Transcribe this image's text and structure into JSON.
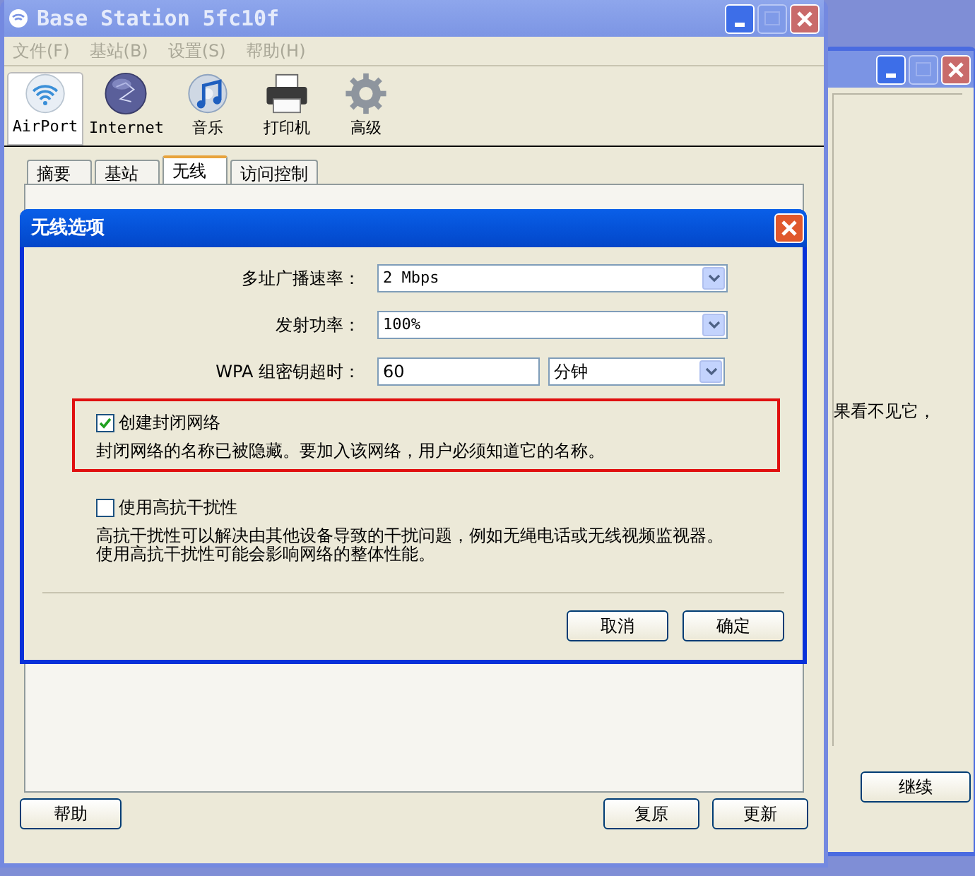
{
  "window": {
    "title": "Base Station 5fc10f"
  },
  "menu": [
    "文件(F)",
    "基站(B)",
    "设置(S)",
    "帮助(H)"
  ],
  "toolbar": [
    {
      "kind": "airport",
      "label": "AirPort",
      "selected": true
    },
    {
      "kind": "internet",
      "label": "Internet",
      "selected": false
    },
    {
      "kind": "music",
      "label": "音乐",
      "selected": false
    },
    {
      "kind": "printer",
      "label": "打印机",
      "selected": false
    },
    {
      "kind": "advanced",
      "label": "高级",
      "selected": false
    }
  ],
  "tabs": [
    {
      "label": "摘要",
      "selected": false
    },
    {
      "label": "基站",
      "selected": false
    },
    {
      "label": "无线",
      "selected": true
    },
    {
      "label": "访问控制",
      "selected": false
    }
  ],
  "footer_buttons": {
    "left": [
      "帮助"
    ],
    "right": [
      "复原",
      "更新"
    ]
  },
  "back_window": {
    "text": "果看不见它，",
    "button": "继续"
  },
  "dialog": {
    "title": "无线选项",
    "fields": [
      {
        "label": "多址广播速率：",
        "value": "2 Mbps",
        "kind": "select"
      },
      {
        "label": "发射功率：",
        "value": "100%",
        "kind": "select"
      },
      {
        "label": "WPA 组密钥超时：",
        "value": "60",
        "kind": "input",
        "unit": "分钟"
      }
    ],
    "options": [
      {
        "label": "创建封闭网络",
        "checked": true,
        "highlighted": true,
        "description": [
          "封闭网络的名称已被隐藏。要加入该网络，用户必须知道它的名称。"
        ]
      },
      {
        "label": "使用高抗干扰性",
        "checked": false,
        "highlighted": false,
        "description": [
          "高抗干扰性可以解决由其他设备导致的干扰问题，例如无绳电话或无线视频监视器。",
          "使用高抗干扰性可能会影响网络的整体性能。"
        ]
      }
    ],
    "buttons": [
      "取消",
      "确定"
    ]
  }
}
